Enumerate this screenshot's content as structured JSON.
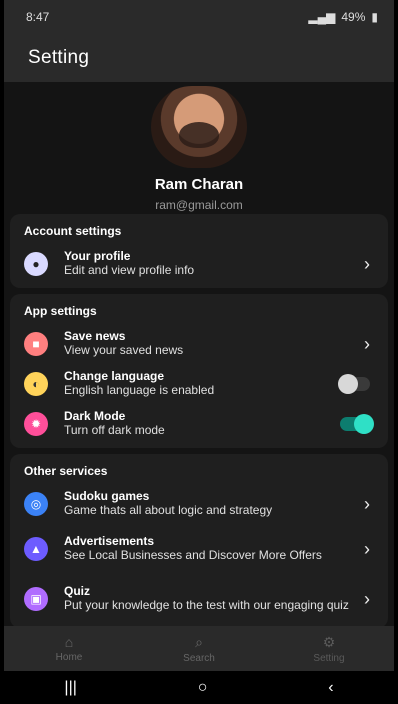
{
  "status": {
    "time": "8:47",
    "battery": "49%"
  },
  "header": {
    "title": "Setting"
  },
  "profile": {
    "name": "Ram Charan",
    "email": "ram@gmail.com"
  },
  "account": {
    "title": "Account settings",
    "items": [
      {
        "title": "Your profile",
        "subtitle": "Edit and view profile info",
        "icon": "user-icon"
      }
    ]
  },
  "app": {
    "title": "App settings",
    "items": [
      {
        "title": "Save news",
        "subtitle": "View your saved news",
        "icon": "bookmark-icon"
      },
      {
        "title": "Change language",
        "subtitle": "English language is enabled",
        "icon": "language-icon",
        "toggle": false
      },
      {
        "title": "Dark Mode",
        "subtitle": "Turn off dark mode",
        "icon": "dark-mode-icon",
        "toggle": true
      }
    ]
  },
  "other": {
    "title": "Other services",
    "items": [
      {
        "title": "Sudoku games",
        "subtitle": "Game thats all about logic and strategy",
        "icon": "gamepad-icon"
      },
      {
        "title": "Advertisements",
        "subtitle": "See Local Businesses and Discover More Offers",
        "icon": "ads-icon"
      },
      {
        "title": "Quiz",
        "subtitle": "Put your knowledge to the test with our engaging quiz",
        "icon": "quiz-icon"
      }
    ]
  },
  "bottom_nav": [
    {
      "label": "Home",
      "icon": "home-icon"
    },
    {
      "label": "Search",
      "icon": "search-icon"
    },
    {
      "label": "Setting",
      "icon": "settings-icon"
    }
  ],
  "colors": {
    "accent": "#2fe0c6",
    "background": "#141414",
    "card": "#1f1f1f"
  }
}
